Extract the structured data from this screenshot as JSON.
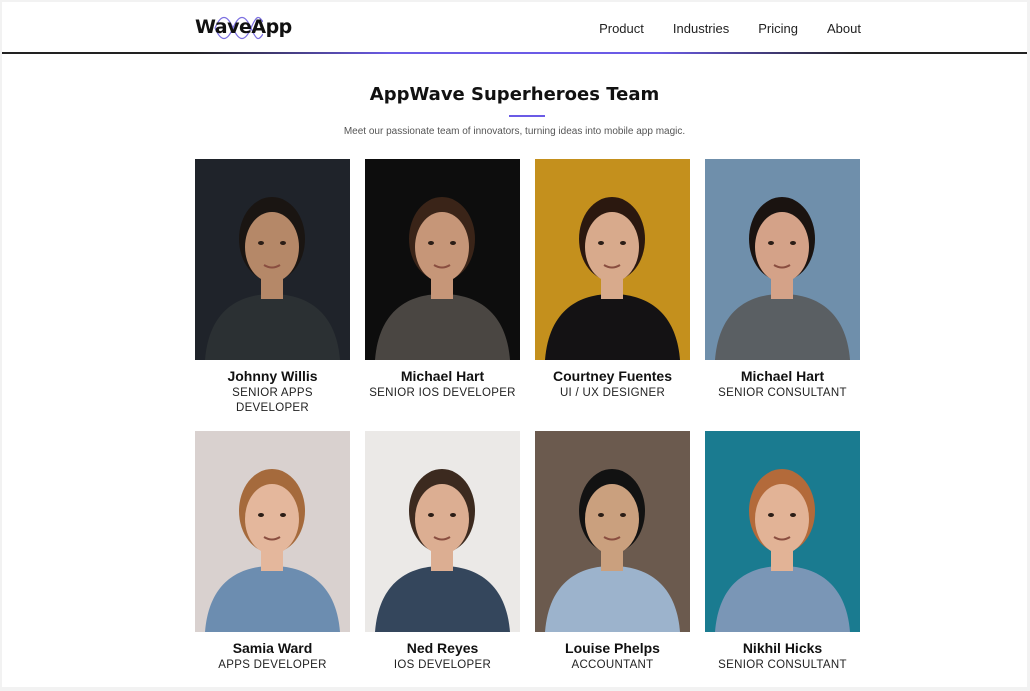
{
  "header": {
    "logo_text": "WaveApp",
    "nav": [
      "Product",
      "Industries",
      "Pricing",
      "About"
    ]
  },
  "section": {
    "title": "AppWave Superheroes Team",
    "subtitle": "Meet our passionate team of innovators, turning ideas into mobile app magic."
  },
  "team": [
    {
      "name": "Johnny Willis",
      "role": "SENIOR APPS DEVELOPER",
      "bg": "#1f232a",
      "skin": "#b58868",
      "hair": "#1a1512",
      "shirt": "#2b3033"
    },
    {
      "name": "Michael Hart",
      "role": "SENIOR IOS DEVELOPER",
      "bg": "#0d0d0d",
      "skin": "#c69678",
      "hair": "#3a2418",
      "shirt": "#4a4642"
    },
    {
      "name": "Courtney Fuentes",
      "role": "UI / UX DESIGNER",
      "bg": "#c4901d",
      "skin": "#d8aa8c",
      "hair": "#2b180f",
      "shirt": "#141214"
    },
    {
      "name": "Michael Hart",
      "role": "SENIOR CONSULTANT",
      "bg": "#6f8fab",
      "skin": "#d4a288",
      "hair": "#1a1310",
      "shirt": "#5a5f63"
    },
    {
      "name": "Samia Ward",
      "role": "APPS DEVELOPER",
      "bg": "#d9d1cf",
      "skin": "#e4b79c",
      "hair": "#a56a3c",
      "shirt": "#6c8db0"
    },
    {
      "name": "Ned Reyes",
      "role": "IOS DEVELOPER",
      "bg": "#ebe9e7",
      "skin": "#dcae92",
      "hair": "#3c2a1f",
      "shirt": "#34465c"
    },
    {
      "name": "Louise Phelps",
      "role": "ACCOUNTANT",
      "bg": "#6b5a4e",
      "skin": "#caa07e",
      "hair": "#121212",
      "shirt": "#9cb3cc"
    },
    {
      "name": "Nikhil Hicks",
      "role": "SENIOR CONSULTANT",
      "bg": "#1a7b90",
      "skin": "#e2b396",
      "hair": "#b36a3a",
      "shirt": "#7a96b6"
    }
  ]
}
